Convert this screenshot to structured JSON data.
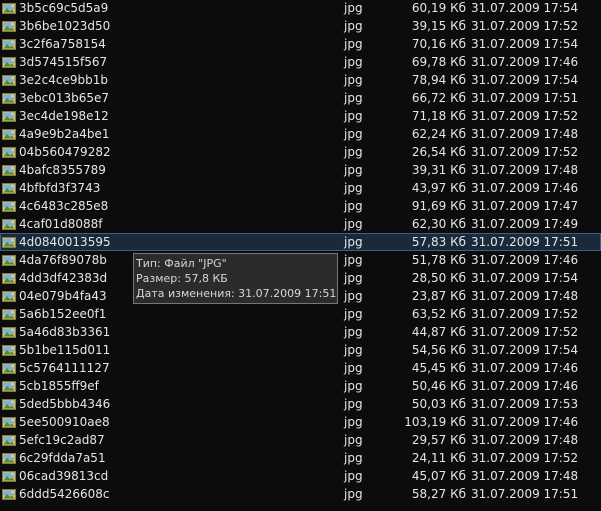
{
  "files": [
    {
      "name": "3b5c69c5d5a9",
      "ext": "jpg",
      "size": "60,19 Кб",
      "date": "31.07.2009 17:54"
    },
    {
      "name": "3b6be1023d50",
      "ext": "jpg",
      "size": "39,15 Кб",
      "date": "31.07.2009 17:52"
    },
    {
      "name": "3c2f6a758154",
      "ext": "jpg",
      "size": "70,16 Кб",
      "date": "31.07.2009 17:54"
    },
    {
      "name": "3d574515f567",
      "ext": "jpg",
      "size": "69,78 Кб",
      "date": "31.07.2009 17:46"
    },
    {
      "name": "3e2c4ce9bb1b",
      "ext": "jpg",
      "size": "78,94 Кб",
      "date": "31.07.2009 17:54"
    },
    {
      "name": "3ebc013b65e7",
      "ext": "jpg",
      "size": "66,72 Кб",
      "date": "31.07.2009 17:51"
    },
    {
      "name": "3ec4de198e12",
      "ext": "jpg",
      "size": "71,18 Кб",
      "date": "31.07.2009 17:52"
    },
    {
      "name": "4a9e9b2a4be1",
      "ext": "jpg",
      "size": "62,24 Кб",
      "date": "31.07.2009 17:48"
    },
    {
      "name": "04b560479282",
      "ext": "jpg",
      "size": "26,54 Кб",
      "date": "31.07.2009 17:52"
    },
    {
      "name": "4bafc8355789",
      "ext": "jpg",
      "size": "39,31 Кб",
      "date": "31.07.2009 17:48"
    },
    {
      "name": "4bfbfd3f3743",
      "ext": "jpg",
      "size": "43,97 Кб",
      "date": "31.07.2009 17:46"
    },
    {
      "name": "4c6483c285e8",
      "ext": "jpg",
      "size": "91,69 Кб",
      "date": "31.07.2009 17:47"
    },
    {
      "name": "4caf01d8088f",
      "ext": "jpg",
      "size": "62,30 Кб",
      "date": "31.07.2009 17:49"
    },
    {
      "name": "4d0840013595",
      "ext": "jpg",
      "size": "57,83 Кб",
      "date": "31.07.2009 17:51",
      "selected": true
    },
    {
      "name": "4da76f89078b",
      "ext": "jpg",
      "size": "51,78 Кб",
      "date": "31.07.2009 17:46"
    },
    {
      "name": "4dd3df42383d",
      "ext": "jpg",
      "size": "28,50 Кб",
      "date": "31.07.2009 17:54"
    },
    {
      "name": "04e079b4fa43",
      "ext": "jpg",
      "size": "23,87 Кб",
      "date": "31.07.2009 17:48"
    },
    {
      "name": "5a6b152ee0f1",
      "ext": "jpg",
      "size": "63,52 Кб",
      "date": "31.07.2009 17:52"
    },
    {
      "name": "5a46d83b3361",
      "ext": "jpg",
      "size": "44,87 Кб",
      "date": "31.07.2009 17:52"
    },
    {
      "name": "5b1be115d011",
      "ext": "jpg",
      "size": "54,56 Кб",
      "date": "31.07.2009 17:54"
    },
    {
      "name": "5c5764111127",
      "ext": "jpg",
      "size": "45,45 Кб",
      "date": "31.07.2009 17:46"
    },
    {
      "name": "5cb1855ff9ef",
      "ext": "jpg",
      "size": "50,46 Кб",
      "date": "31.07.2009 17:46"
    },
    {
      "name": "5ded5bbb4346",
      "ext": "jpg",
      "size": "50,03 Кб",
      "date": "31.07.2009 17:53"
    },
    {
      "name": "5ee500910ae8",
      "ext": "jpg",
      "size": "103,19 Кб",
      "date": "31.07.2009 17:46"
    },
    {
      "name": "5efc19c2ad87",
      "ext": "jpg",
      "size": "29,57 Кб",
      "date": "31.07.2009 17:48"
    },
    {
      "name": "6c29fdda7a51",
      "ext": "jpg",
      "size": "24,11 Кб",
      "date": "31.07.2009 17:52"
    },
    {
      "name": "06cad39813cd",
      "ext": "jpg",
      "size": "45,07 Кб",
      "date": "31.07.2009 17:48"
    },
    {
      "name": "6ddd5426608c",
      "ext": "jpg",
      "size": "58,27 Кб",
      "date": "31.07.2009 17:51"
    }
  ],
  "tooltip": {
    "type_line": "Тип: Файл \"JPG\"",
    "size_line": "Размер: 57,8 КБ",
    "modified_line": "Дата изменения: 31.07.2009 17:51"
  },
  "colors": {
    "background": "#0c0c0c",
    "text": "#e6e6e6",
    "selection": "#1b2a3b",
    "selection_border": "#3b5f86",
    "tooltip_bg": "#2b2b2b",
    "tooltip_border": "#767676"
  },
  "icons": {
    "file": "jpg-image-file-icon"
  }
}
